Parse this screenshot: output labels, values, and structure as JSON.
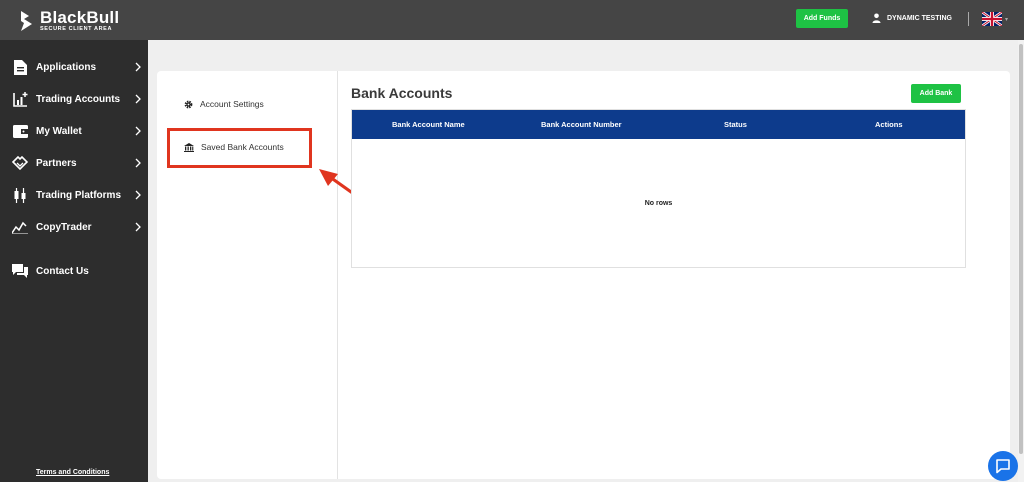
{
  "brand": {
    "name": "BlackBull",
    "subtitle": "SECURE CLIENT AREA"
  },
  "header": {
    "add_funds_label": "Add Funds",
    "user_name": "DYNAMIC TESTING",
    "language_icon": "uk-flag-icon"
  },
  "sidebar": {
    "items": [
      {
        "label": "Applications",
        "icon": "document-icon"
      },
      {
        "label": "Trading Accounts",
        "icon": "chart-plus-icon"
      },
      {
        "label": "My Wallet",
        "icon": "wallet-icon"
      },
      {
        "label": "Partners",
        "icon": "handshake-icon"
      },
      {
        "label": "Trading Platforms",
        "icon": "candlestick-icon"
      },
      {
        "label": "CopyTrader",
        "icon": "trend-icon"
      },
      {
        "label": "Contact Us",
        "icon": "chat-icon"
      }
    ],
    "terms_label": "Terms and Conditions"
  },
  "settings_menu": {
    "items": [
      {
        "label": "Account Settings",
        "icon": "gear-icon"
      },
      {
        "label": "Saved Bank Accounts",
        "icon": "bank-icon"
      }
    ]
  },
  "main": {
    "title": "Bank Accounts",
    "add_bank_label": "Add Bank",
    "table": {
      "columns": [
        "Bank Account Name",
        "Bank Account Number",
        "Status",
        "Actions"
      ],
      "empty_text": "No rows"
    }
  },
  "colors": {
    "topbar": "#454545",
    "sidebar": "#2d2d2d",
    "accent_green": "#1ec244",
    "table_header": "#0d3b8c",
    "annotation_red": "#e0351f",
    "chat_blue": "#1a73e8"
  }
}
